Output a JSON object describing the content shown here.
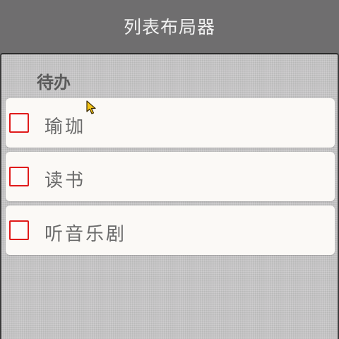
{
  "window": {
    "title": "列表布局器"
  },
  "section": {
    "title": "待办"
  },
  "todo_items": [
    {
      "label": "瑜珈",
      "checked": false
    },
    {
      "label": "读书",
      "checked": false
    },
    {
      "label": "听音乐剧",
      "checked": false
    }
  ],
  "colors": {
    "titlebar_bg": "#6f6e6f",
    "panel_bg": "#c4c3c4",
    "item_bg": "#fbf9f6",
    "checkbox_border": "#e01b1b",
    "label_text": "#6a6a6a"
  },
  "icons": {
    "cursor": "mouse-pointer-icon"
  }
}
